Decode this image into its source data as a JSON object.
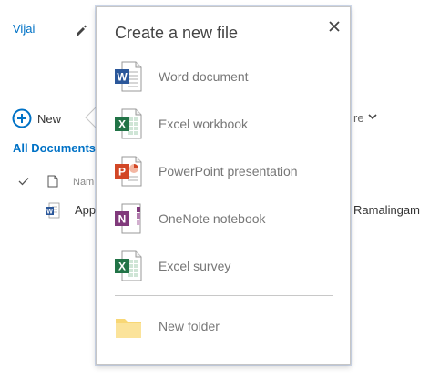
{
  "site": {
    "title": "Vijai"
  },
  "toolbar": {
    "new_label": "New",
    "more_label": "re"
  },
  "view": {
    "name": "All Documents"
  },
  "list": {
    "header_name": "Nam",
    "rows": [
      {
        "name": "App",
        "author": "Ramalingam"
      }
    ]
  },
  "popup": {
    "title": "Create a new file",
    "items": [
      {
        "label": "Word document",
        "icon": "word-icon",
        "color": "#2b579a"
      },
      {
        "label": "Excel workbook",
        "icon": "excel-icon",
        "color": "#217346"
      },
      {
        "label": "PowerPoint presentation",
        "icon": "powerpoint-icon",
        "color": "#d24726"
      },
      {
        "label": "OneNote notebook",
        "icon": "onenote-icon",
        "color": "#80397b"
      },
      {
        "label": "Excel survey",
        "icon": "excel-survey-icon",
        "color": "#217346"
      },
      {
        "label": "New folder",
        "icon": "folder-icon",
        "color": "#f8d775"
      }
    ]
  }
}
